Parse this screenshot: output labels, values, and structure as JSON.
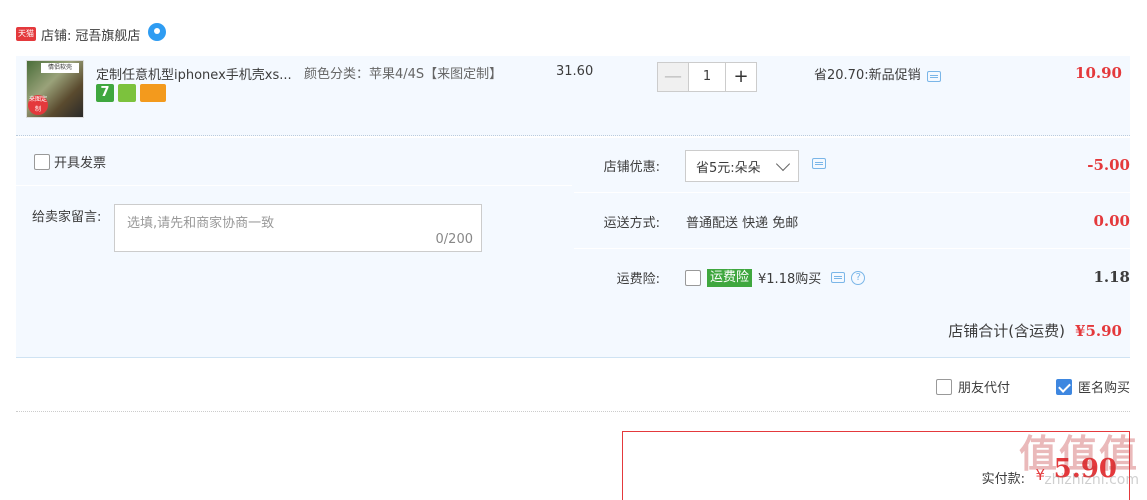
{
  "shop": {
    "logo_text": "天猫",
    "label": "店铺:",
    "name": "冠吾旗舰店"
  },
  "item": {
    "thumb_banner": "情侣软壳",
    "thumb_tag": "来图定制",
    "title": "定制任意机型iphonex手机壳xs...",
    "badge_7": "7",
    "sku": "颜色分类：苹果4/4S【来图定制】",
    "unit_price": "31.60",
    "quantity_minus": "—",
    "quantity": "1",
    "quantity_plus": "+",
    "promo": "省20.70:新品促销",
    "subtotal": "10.90"
  },
  "options": {
    "invoice_label": "开具发票",
    "message_label": "给卖家留言:",
    "message_placeholder": "选填,请先和商家协商一致",
    "message_count": "0/200",
    "discount_label": "店铺优惠:",
    "discount_selected": "省5元:朵朵",
    "discount_amount": "-5.00",
    "shipping_label": "运送方式:",
    "shipping_value": "普通配送 快递 免邮",
    "shipping_amount": "0.00",
    "insurance_label": "运费险:",
    "insurance_tag": "运费险",
    "insurance_desc": "¥1.18购买",
    "insurance_help": "?",
    "insurance_amount": "1.18",
    "shop_total_label": "店铺合计(含运费)",
    "shop_total_amount": "¥5.90"
  },
  "extras": {
    "friend_pay_label": "朋友代付",
    "anonymous_label": "匿名购买",
    "anonymous_checked": true
  },
  "payment": {
    "label": "实付款:",
    "currency": "¥",
    "amount": "5.90"
  },
  "watermark": {
    "chars": "值值值",
    "url": "zhizhizhi.com"
  },
  "colors": {
    "accent_red": "#e4393c",
    "row_bg": "#f4f9ff",
    "checkbox_blue": "#3e87e0"
  }
}
